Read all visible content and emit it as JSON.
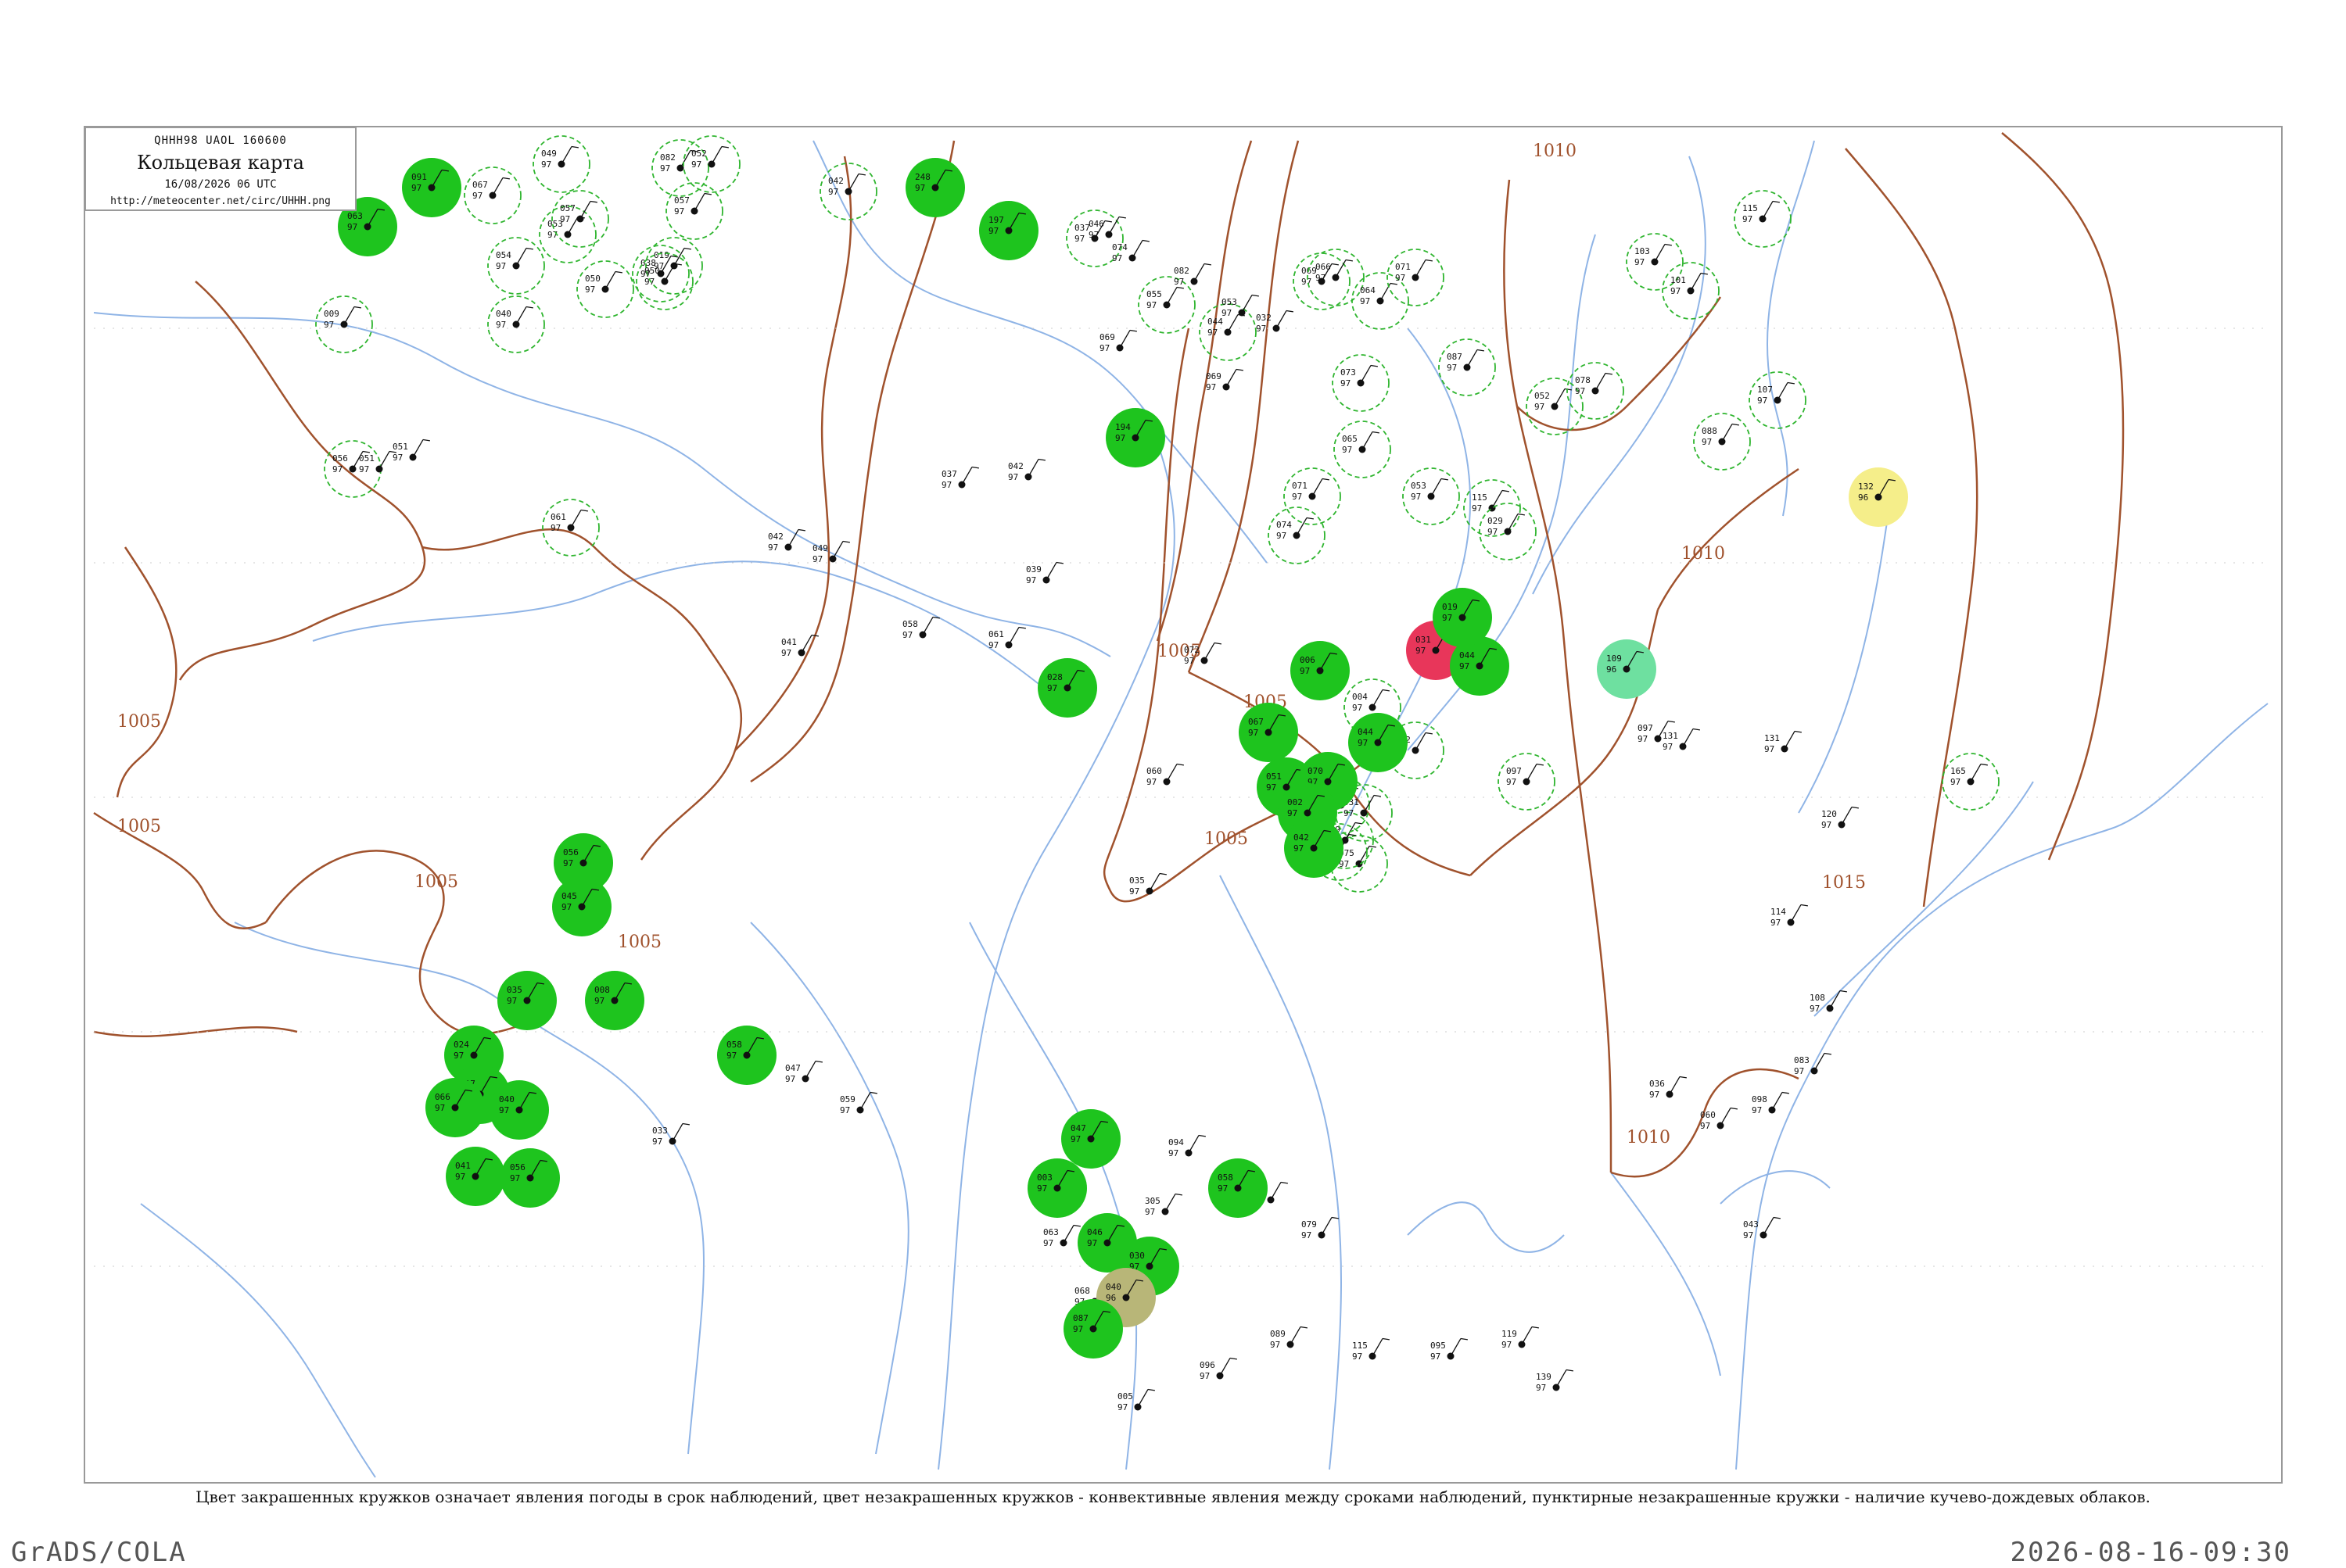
{
  "header": {
    "code_line": "QHHH98  UAOL  160600",
    "title": "Кольцевая карта",
    "date": "16/08/2026 06 UTC",
    "url": "http://meteocenter.net/circ/UHHH.png"
  },
  "caption": "Цвет закрашенных кружков означает явления погоды в срок наблюдений, цвет незакрашенных кружков - конвективные явления между сроками наблюдений, пунктирные незакрашенные кружки - наличие кучево-дождевых облаков.",
  "footer": {
    "left": "GrADS/COLA",
    "right": "2026-08-16-09:30"
  },
  "colors": {
    "shower": "#1ec41e",
    "thunder": "#e8365a",
    "drizzle": "#6ee0a0",
    "fog": "#f5ee8a",
    "haze": "#b8b678",
    "dashed_ring": "#2fb52f",
    "isobar": "#a0522d",
    "river": "#8fb4e6",
    "frame": "#999999"
  },
  "isobars": [
    "1005",
    "1005",
    "1005",
    "1005",
    "1005",
    "1005",
    "1005",
    "1010",
    "1010",
    "1010",
    "1015"
  ],
  "filled_stations": [
    {
      "type": "shower",
      "pressure": "091",
      "temp": "97"
    },
    {
      "type": "shower",
      "pressure": "063",
      "temp": "97"
    },
    {
      "type": "shower",
      "pressure": "248",
      "temp": "97"
    },
    {
      "type": "shower",
      "pressure": "197",
      "temp": "97"
    },
    {
      "type": "shower",
      "pressure": "194",
      "temp": "97"
    },
    {
      "type": "shower",
      "pressure": "028",
      "temp": "97"
    },
    {
      "type": "thunder",
      "pressure": "031",
      "temp": "97"
    },
    {
      "type": "shower",
      "pressure": "044",
      "temp": "97"
    },
    {
      "type": "drizzle",
      "pressure": "109",
      "temp": "96"
    },
    {
      "type": "fog",
      "pressure": "132",
      "temp": "96"
    },
    {
      "type": "shower",
      "pressure": "019",
      "temp": "97"
    },
    {
      "type": "shower",
      "pressure": "006",
      "temp": "97"
    },
    {
      "type": "shower",
      "pressure": "044",
      "temp": "97"
    },
    {
      "type": "shower",
      "pressure": "067",
      "temp": "97"
    },
    {
      "type": "shower",
      "pressure": "051",
      "temp": "97"
    },
    {
      "type": "shower",
      "pressure": "070",
      "temp": "97"
    },
    {
      "type": "shower",
      "pressure": "002",
      "temp": "97"
    },
    {
      "type": "shower",
      "pressure": "042",
      "temp": "97"
    },
    {
      "type": "shower",
      "pressure": "056",
      "temp": "97"
    },
    {
      "type": "shower",
      "pressure": "045",
      "temp": "97"
    },
    {
      "type": "shower",
      "pressure": "008",
      "temp": "97"
    },
    {
      "type": "shower",
      "pressure": "035",
      "temp": "97"
    },
    {
      "type": "shower",
      "pressure": "024",
      "temp": "97"
    },
    {
      "type": "shower",
      "pressure": "017",
      "temp": "97"
    },
    {
      "type": "shower",
      "pressure": "040",
      "temp": "97"
    },
    {
      "type": "shower",
      "pressure": "066",
      "temp": "97"
    },
    {
      "type": "shower",
      "pressure": "041",
      "temp": "97"
    },
    {
      "type": "shower",
      "pressure": "056",
      "temp": "97"
    },
    {
      "type": "shower",
      "pressure": "058",
      "temp": "97"
    },
    {
      "type": "shower",
      "pressure": "047",
      "temp": "97"
    },
    {
      "type": "shower",
      "pressure": "003",
      "temp": "97"
    },
    {
      "type": "shower",
      "pressure": "058",
      "temp": "97"
    },
    {
      "type": "shower",
      "pressure": "046",
      "temp": "97"
    },
    {
      "type": "shower",
      "pressure": "030",
      "temp": "97"
    },
    {
      "type": "haze",
      "pressure": "040",
      "temp": "96"
    },
    {
      "type": "shower",
      "pressure": "087",
      "temp": "97"
    }
  ],
  "plain_stations": [
    {
      "pressure": "046",
      "temp": "97"
    },
    {
      "pressure": "074",
      "temp": "97"
    },
    {
      "pressure": "082",
      "temp": "97"
    },
    {
      "pressure": "053",
      "temp": "97"
    },
    {
      "pressure": "032",
      "temp": "97"
    },
    {
      "pressure": "069",
      "temp": "97"
    },
    {
      "pressure": "069",
      "temp": "97"
    },
    {
      "pressure": "042",
      "temp": "97"
    },
    {
      "pressure": "037",
      "temp": "97"
    },
    {
      "pressure": "049",
      "temp": "97"
    },
    {
      "pressure": "051",
      "temp": "97"
    },
    {
      "pressure": "051",
      "temp": "97"
    },
    {
      "pressure": "042",
      "temp": "97"
    },
    {
      "pressure": "039",
      "temp": "97"
    },
    {
      "pressure": "058",
      "temp": "97"
    },
    {
      "pressure": "061",
      "temp": "97"
    },
    {
      "pressure": "041",
      "temp": "97"
    },
    {
      "pressure": "072",
      "temp": "97"
    },
    {
      "pressure": "060",
      "temp": "97"
    },
    {
      "pressure": "035",
      "temp": "97"
    },
    {
      "pressure": "097",
      "temp": "97"
    },
    {
      "pressure": "131",
      "temp": "97"
    },
    {
      "pressure": "131",
      "temp": "97"
    },
    {
      "pressure": "120",
      "temp": "97"
    },
    {
      "pressure": "114",
      "temp": "97"
    },
    {
      "pressure": "108",
      "temp": "97"
    },
    {
      "pressure": "083",
      "temp": "97"
    },
    {
      "pressure": "098",
      "temp": "97"
    },
    {
      "pressure": "059",
      "temp": "97"
    },
    {
      "pressure": "047",
      "temp": "97"
    },
    {
      "pressure": "033",
      "temp": "97"
    },
    {
      "pressure": "094",
      "temp": "97"
    },
    {
      "pressure": "081",
      "temp": "97"
    },
    {
      "pressure": "305",
      "temp": "97"
    },
    {
      "pressure": "078",
      "temp": "97"
    },
    {
      "pressure": "079",
      "temp": "97"
    },
    {
      "pressure": "063",
      "temp": "97"
    },
    {
      "pressure": "068",
      "temp": "97"
    },
    {
      "pressure": "005",
      "temp": "97"
    },
    {
      "pressure": "096",
      "temp": "97"
    },
    {
      "pressure": "089",
      "temp": "97"
    },
    {
      "pressure": "115",
      "temp": "97"
    },
    {
      "pressure": "095",
      "temp": "97"
    },
    {
      "pressure": "119",
      "temp": "97"
    },
    {
      "pressure": "139",
      "temp": "97"
    },
    {
      "pressure": "036",
      "temp": "97"
    },
    {
      "pressure": "060",
      "temp": "97"
    },
    {
      "pressure": "043",
      "temp": "97"
    }
  ],
  "ring_stations": [
    {
      "pressure": "067",
      "temp": "97"
    },
    {
      "pressure": "049",
      "temp": "97"
    },
    {
      "pressure": "053",
      "temp": "97"
    },
    {
      "pressure": "057",
      "temp": "97"
    },
    {
      "pressure": "054",
      "temp": "97"
    },
    {
      "pressure": "040",
      "temp": "97"
    },
    {
      "pressure": "050",
      "temp": "97"
    },
    {
      "pressure": "082",
      "temp": "97"
    },
    {
      "pressure": "019",
      "temp": "97"
    },
    {
      "pressure": "057",
      "temp": "97"
    },
    {
      "pressure": "038",
      "temp": "97"
    },
    {
      "pressure": "050",
      "temp": "97"
    },
    {
      "pressure": "009",
      "temp": "97"
    },
    {
      "pressure": "056",
      "temp": "97"
    },
    {
      "pressure": "061",
      "temp": "97"
    },
    {
      "pressure": "052",
      "temp": "97"
    },
    {
      "pressure": "042",
      "temp": "97"
    },
    {
      "pressure": "037",
      "temp": "97"
    },
    {
      "pressure": "055",
      "temp": "97"
    },
    {
      "pressure": "044",
      "temp": "97"
    },
    {
      "pressure": "069",
      "temp": "97"
    },
    {
      "pressure": "066",
      "temp": "97"
    },
    {
      "pressure": "064",
      "temp": "97"
    },
    {
      "pressure": "071",
      "temp": "97"
    },
    {
      "pressure": "073",
      "temp": "97"
    },
    {
      "pressure": "065",
      "temp": "97"
    },
    {
      "pressure": "074",
      "temp": "97"
    },
    {
      "pressure": "071",
      "temp": "97"
    },
    {
      "pressure": "053",
      "temp": "97"
    },
    {
      "pressure": "087",
      "temp": "97"
    },
    {
      "pressure": "103",
      "temp": "97"
    },
    {
      "pressure": "101",
      "temp": "97"
    },
    {
      "pressure": "088",
      "temp": "97"
    },
    {
      "pressure": "115",
      "temp": "97"
    },
    {
      "pressure": "107",
      "temp": "97"
    },
    {
      "pressure": "165",
      "temp": "97"
    },
    {
      "pressure": "097",
      "temp": "97"
    },
    {
      "pressure": "075",
      "temp": "97"
    },
    {
      "pressure": "069",
      "temp": "97"
    },
    {
      "pressure": "031",
      "temp": "97"
    },
    {
      "pressure": "045",
      "temp": "97"
    },
    {
      "pressure": "004",
      "temp": "97"
    },
    {
      "pressure": "031",
      "temp": "97"
    },
    {
      "pressure": "072",
      "temp": "97"
    },
    {
      "pressure": "115",
      "temp": "97"
    },
    {
      "pressure": "029",
      "temp": "97"
    },
    {
      "pressure": "052",
      "temp": "97"
    },
    {
      "pressure": "078",
      "temp": "97"
    }
  ]
}
